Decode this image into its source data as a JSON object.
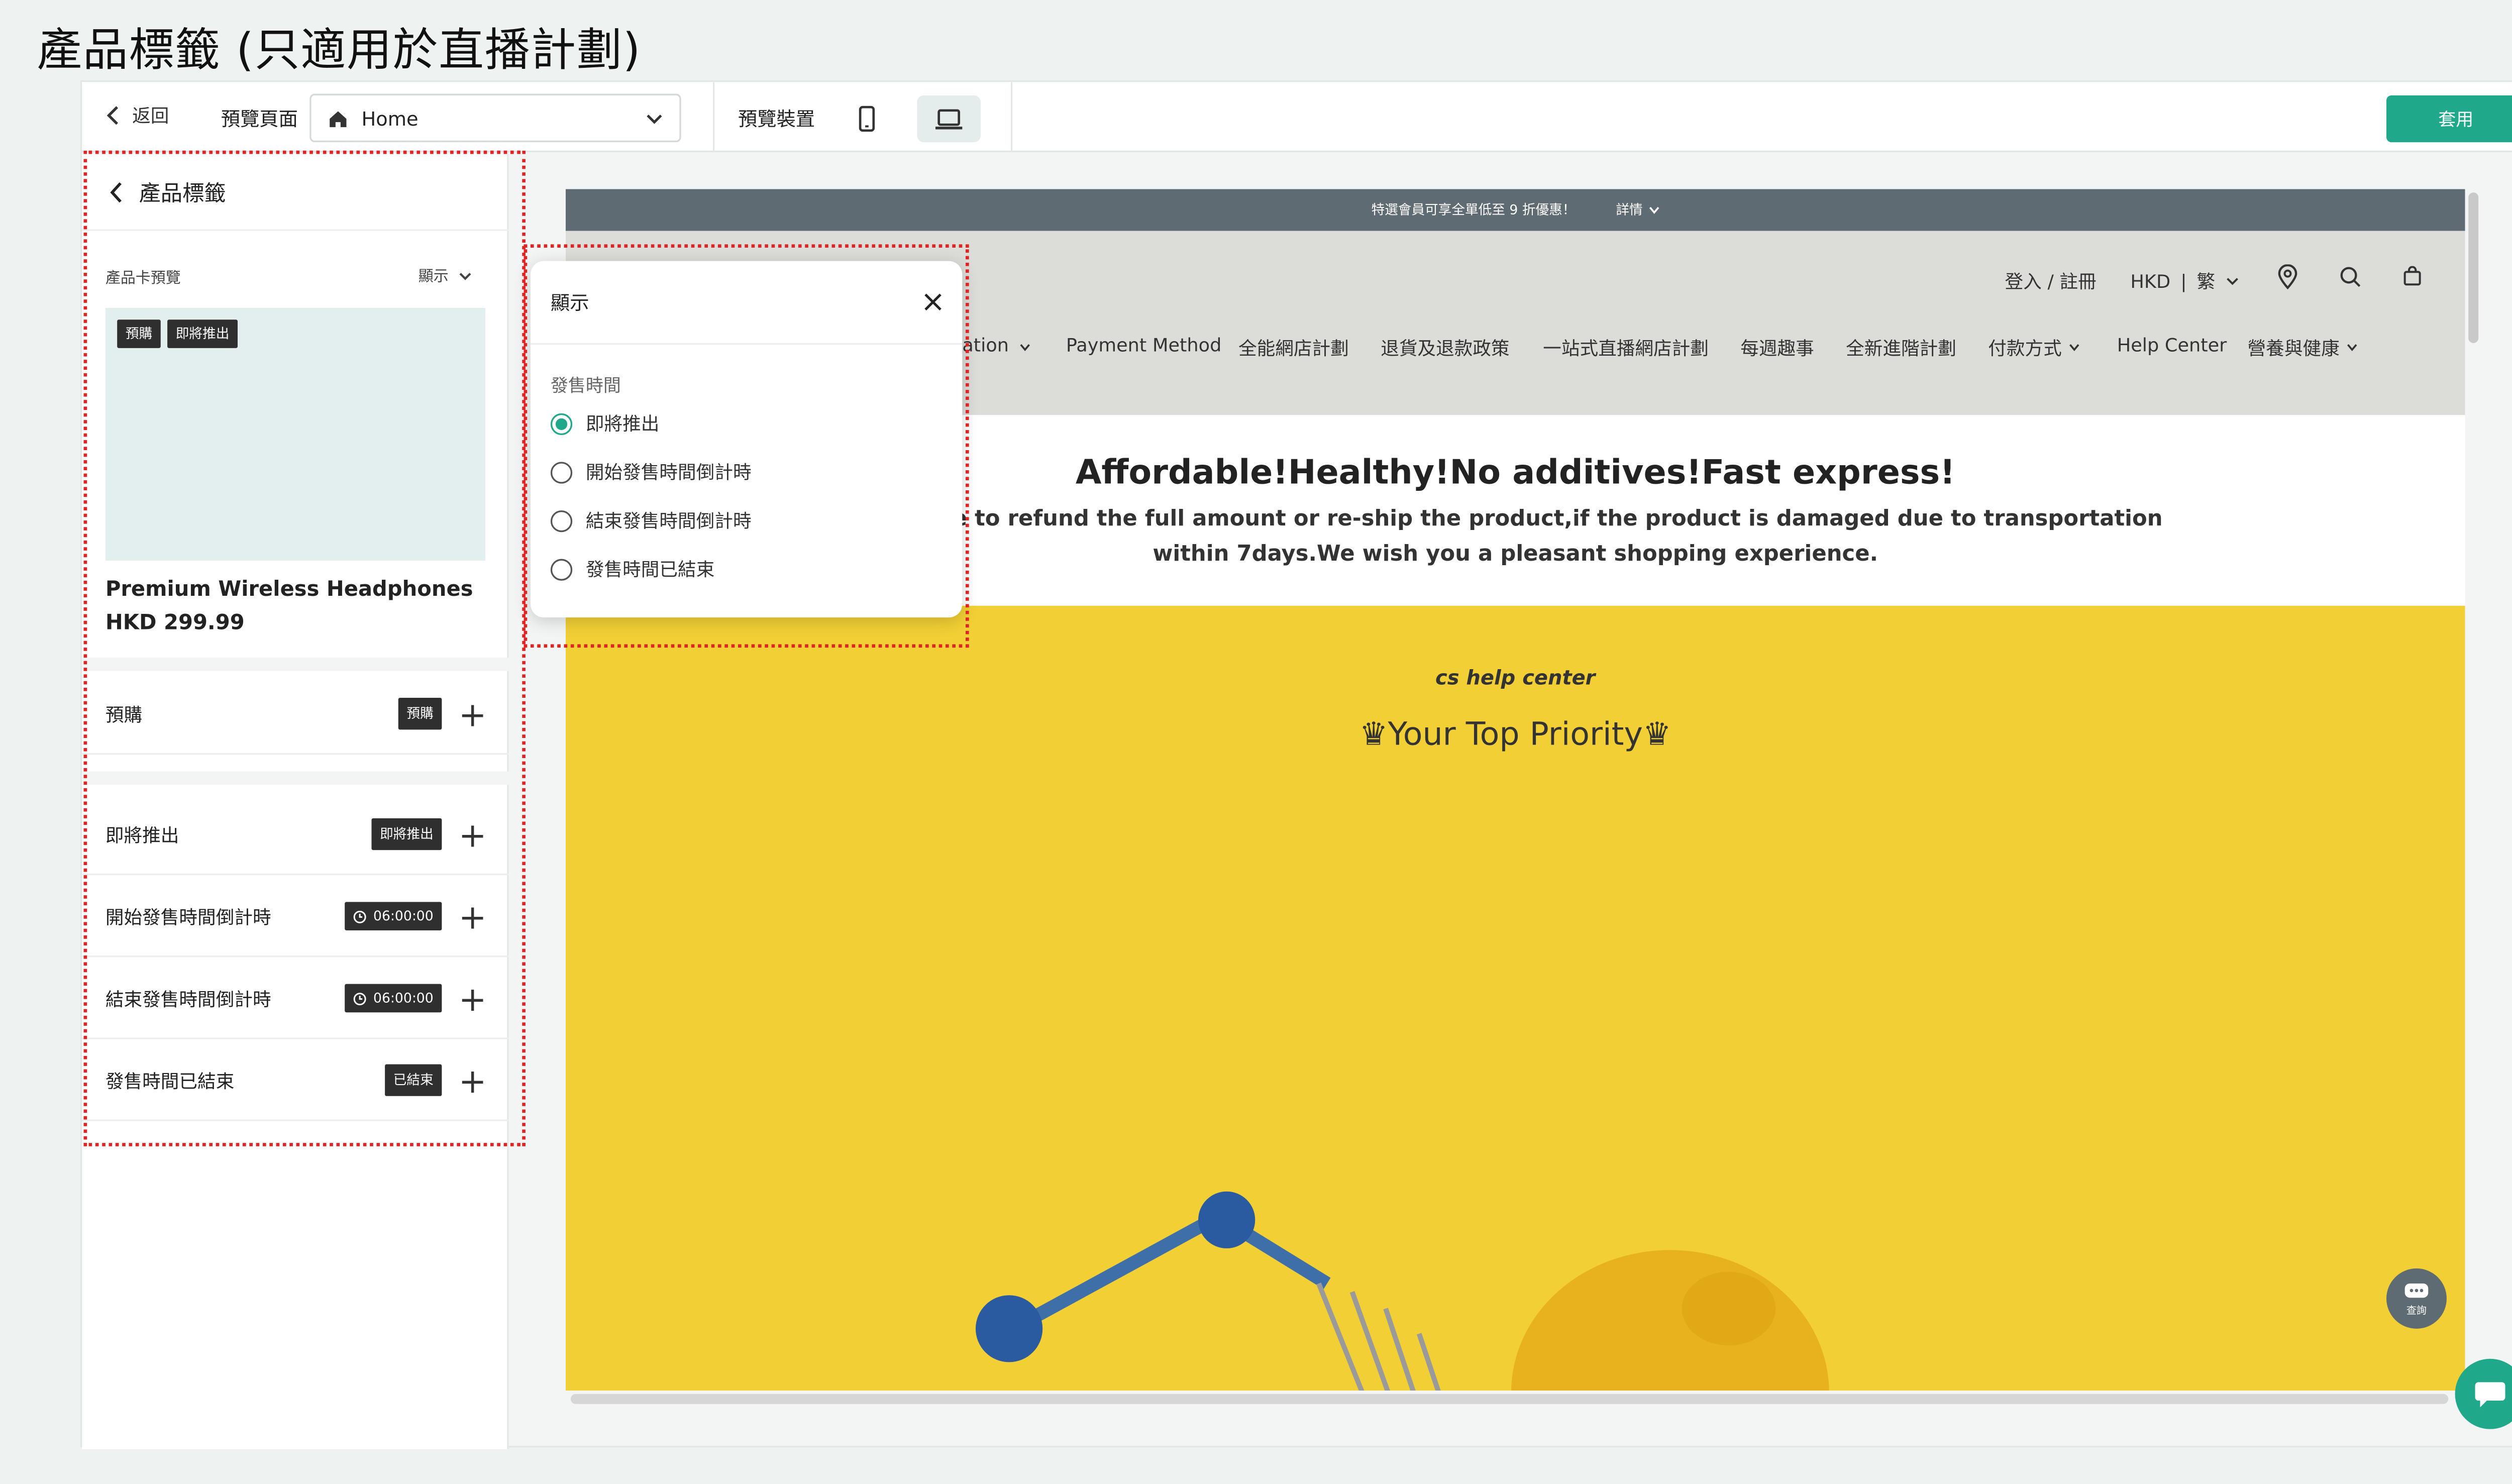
{
  "page_title": "產品標籤 (只適用於直播計劃)",
  "topbar": {
    "back_label": "返回",
    "preview_page_label": "預覽頁面",
    "page_select_value": "Home",
    "preview_device_label": "預覽裝置",
    "apply_label": "套用"
  },
  "sidebar": {
    "header_title": "產品標籤",
    "card_preview_label": "產品卡預覽",
    "display_label": "顯示",
    "preview_tags": [
      "預購",
      "即將推出"
    ],
    "product_name": "Premium Wireless Headphones",
    "product_price": "HKD 299.99",
    "rows": [
      {
        "label": "預購",
        "badge": "預購"
      },
      {
        "label": "即將推出",
        "badge": "即將推出"
      },
      {
        "label": "開始發售時間倒計時",
        "badge": "06:00:00"
      },
      {
        "label": "結束發售時間倒計時",
        "badge": "06:00:00"
      },
      {
        "label": "發售時間已結束",
        "badge": "已結束"
      }
    ]
  },
  "popup": {
    "title": "顯示",
    "section_label": "發售時間",
    "options": [
      "即將推出",
      "開始發售時間倒計時",
      "結束發售時間倒計時",
      "發售時間已結束"
    ],
    "selected_index": 0
  },
  "storefront": {
    "announcement": "特選會員可享全單低至 9 折優惠！",
    "announcement_link": "詳情",
    "account_link": "登入 / 註冊",
    "currency": "HKD",
    "language": "繁",
    "nav_items": [
      "ation",
      "Payment Method",
      "全能網店計劃",
      "退貨及退款政策",
      "一站式直播網店計劃",
      "每週趣事",
      "全新進階計劃",
      "付款方式",
      "Help Center",
      "營養與健康"
    ],
    "headline": "Affordable!Healthy!No additives!Fast express!",
    "subline_1": "promise to refund the full amount or re-ship the product,if the product is damaged due to transportation",
    "subline_2": "within 7days.We wish you a pleasant shopping experience.",
    "banner_small": "cs help center",
    "banner_big": "♛Your Top Priority♛",
    "chat_label": "查詢"
  },
  "colors": {
    "accent": "#1fa88a",
    "highlight_border": "#e02424",
    "banner_bg": "#f2cf35",
    "announce_bg": "#5e6b72"
  }
}
